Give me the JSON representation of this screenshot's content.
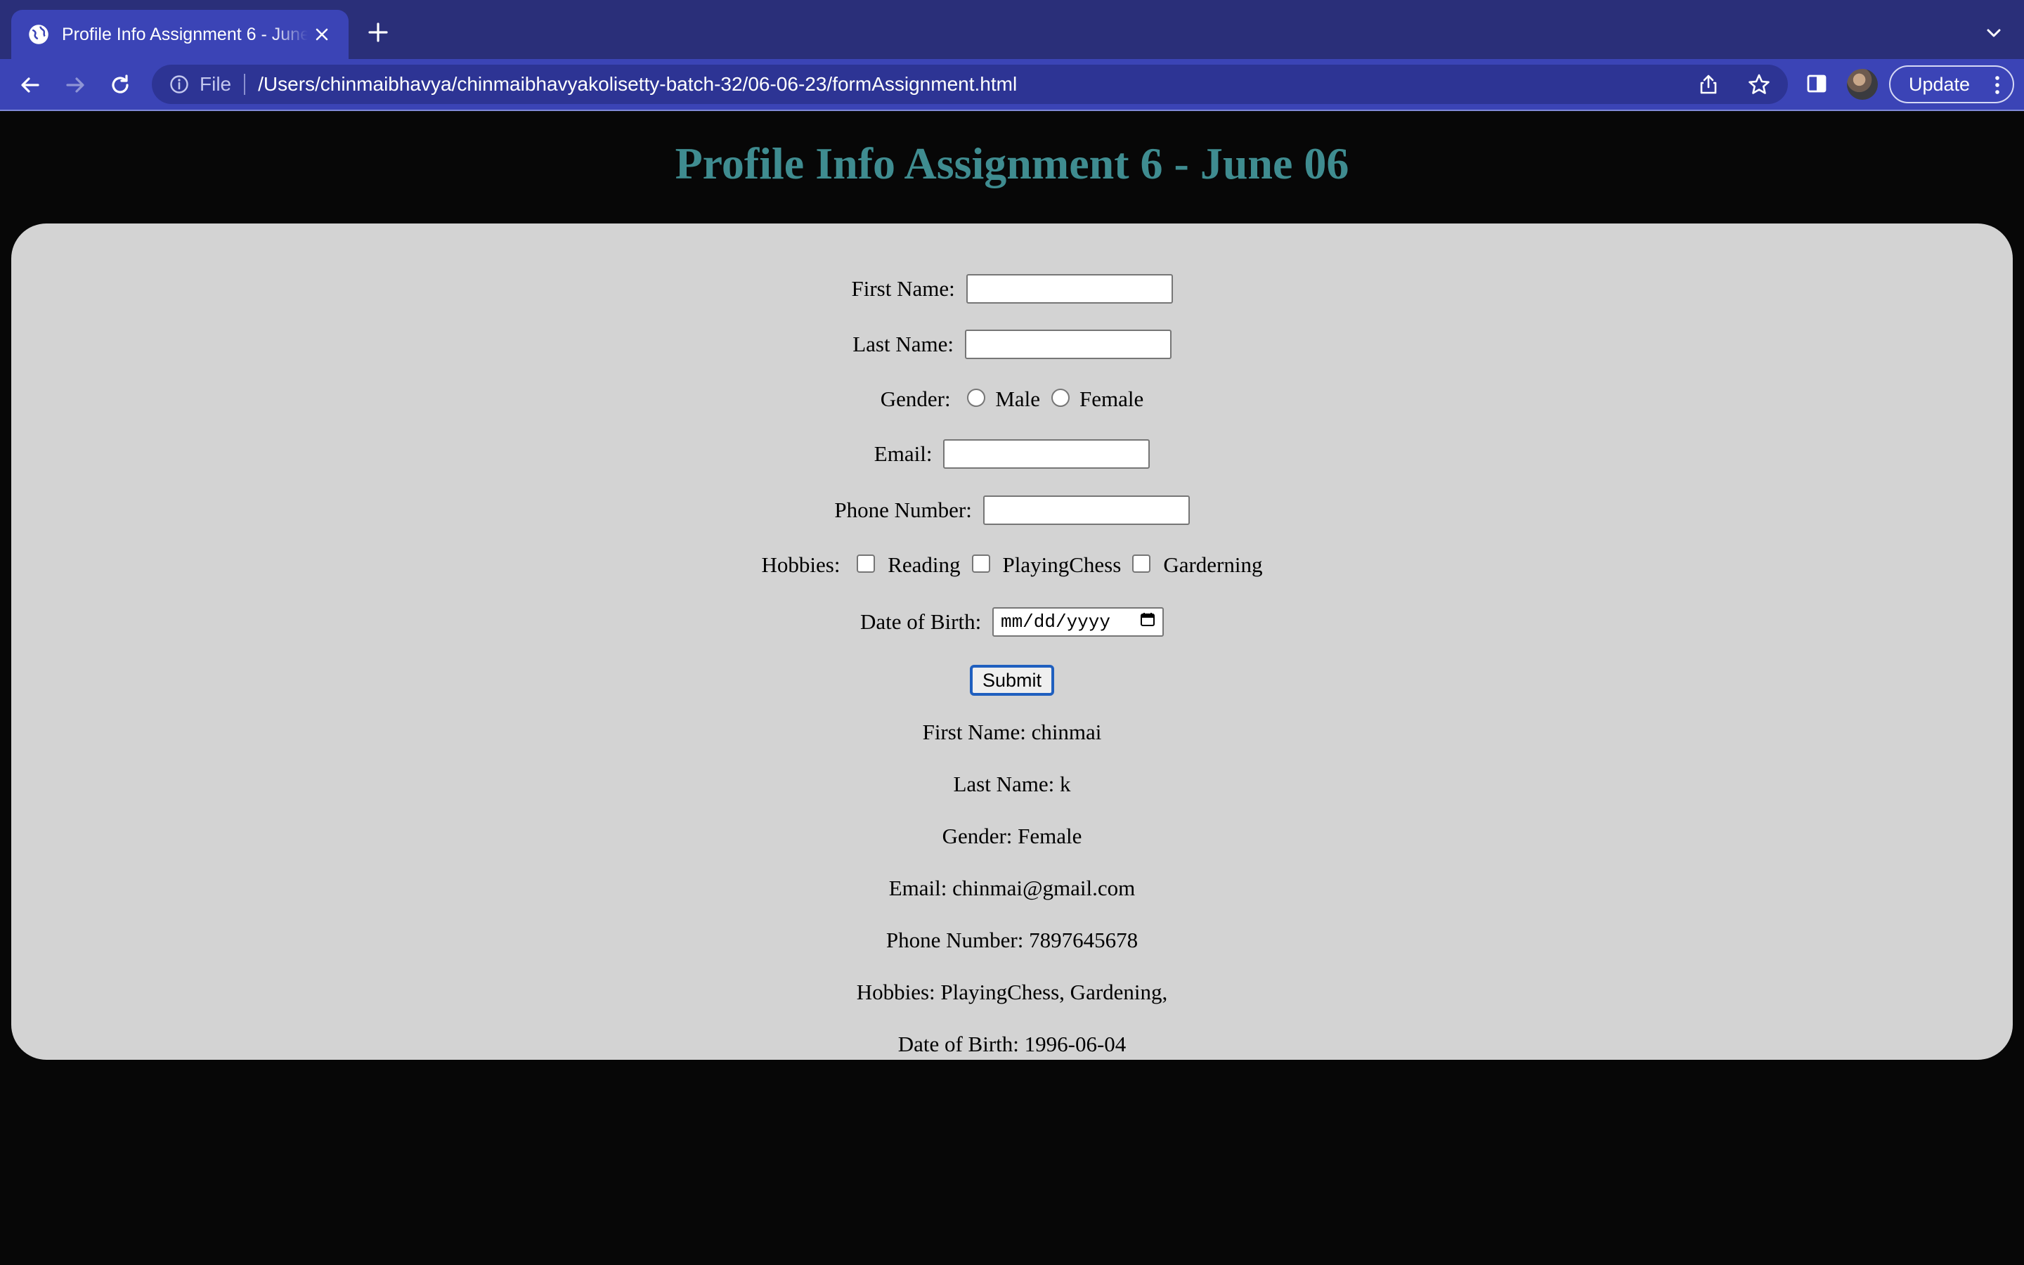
{
  "browser": {
    "tab_title": "Profile Info Assignment 6 - June 06",
    "file_label": "File",
    "url": "/Users/chinmaibhavya/chinmaibhavyakolisetty-batch-32/06-06-23/formAssignment.html",
    "update_label": "Update"
  },
  "page": {
    "title": "Profile Info Assignment 6 - June 06"
  },
  "form": {
    "first_name_label": "First Name: ",
    "last_name_label": "Last Name: ",
    "gender_label": "Gender: ",
    "gender_options": [
      "Male",
      "Female"
    ],
    "email_label": "Email: ",
    "phone_label": "Phone Number: ",
    "hobbies_label": "Hobbies: ",
    "hobby_options": [
      "Reading",
      "PlayingChess",
      "Garderning"
    ],
    "dob_label": "Date of Birth: ",
    "dob_placeholder": "mm/dd/yyyy",
    "submit_label": "Submit"
  },
  "output": {
    "first_name": "First Name: chinmai",
    "last_name": "Last Name: k",
    "gender": "Gender: Female",
    "email": "Email: chinmai@gmail.com",
    "phone": "Phone Number: 7897645678",
    "hobbies": "Hobbies: PlayingChess, Gardening,",
    "dob": "Date of Birth: 1996-06-04"
  },
  "colors": {
    "title": "#3f8c90",
    "card": "#d3d3d3",
    "page_bg": "#070707",
    "chrome_tabbar": "#2a2f79",
    "chrome_toolbar": "#3b44b6"
  }
}
